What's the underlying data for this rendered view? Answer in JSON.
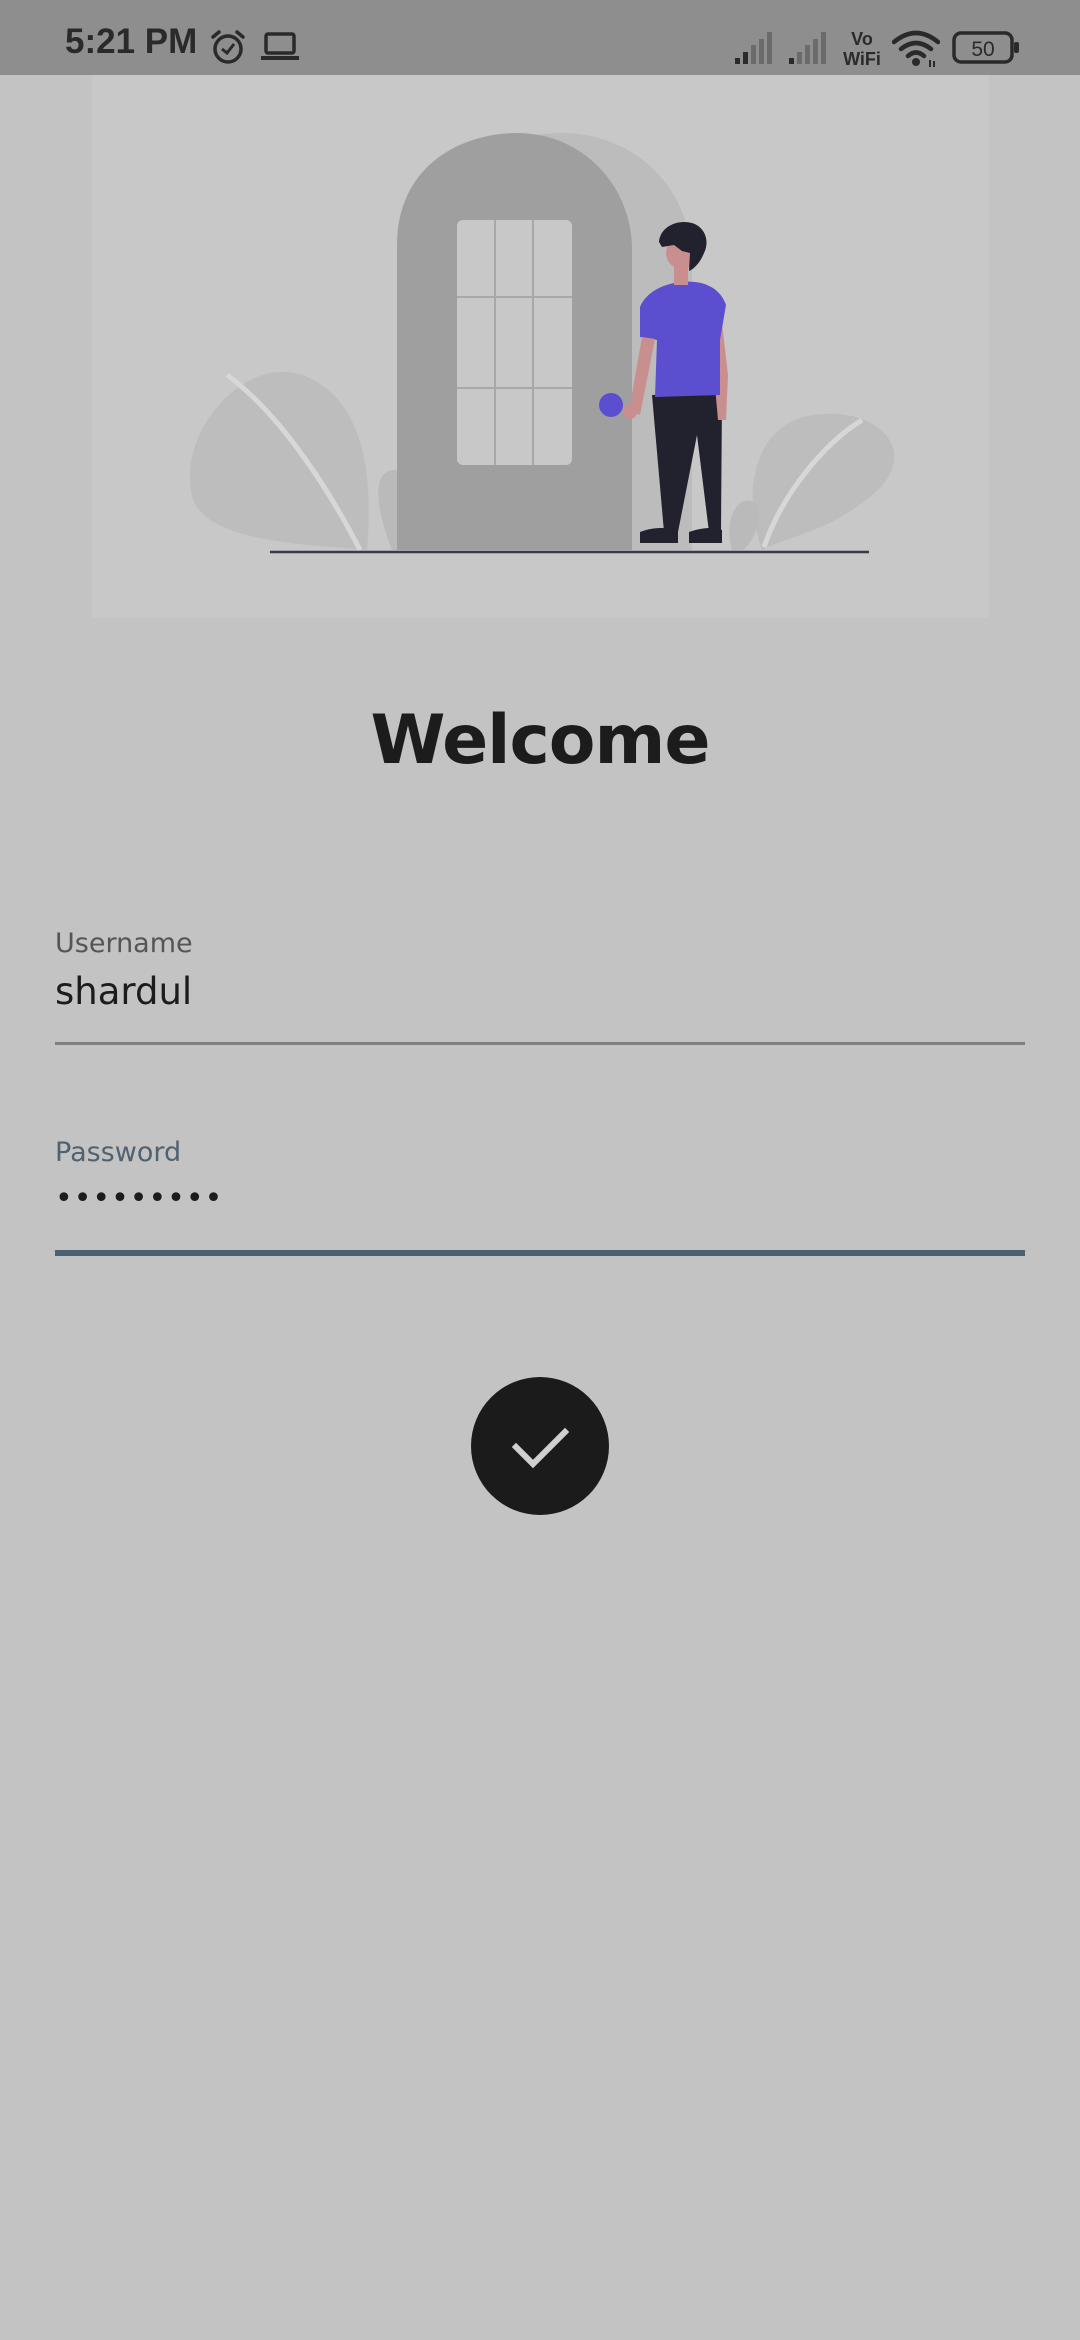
{
  "status_bar": {
    "time": "5:21 PM",
    "battery_level": "50",
    "network_label_top": "Vo",
    "network_label_bottom": "WiFi",
    "icons": [
      "alarm-icon",
      "laptop-icon",
      "signal-icon",
      "signal-icon",
      "vowifi-icon",
      "wifi-icon",
      "battery-icon"
    ]
  },
  "colors": {
    "background": "#c3c3c3",
    "accent": "#4d6171",
    "figure_shirt": "#5b4fcf",
    "button": "#1b1b1b"
  },
  "main": {
    "title": "Welcome"
  },
  "form": {
    "username": {
      "label": "Username",
      "value": "shardul"
    },
    "password": {
      "label": "Password",
      "value": "•••••••••"
    },
    "submit_icon": "checkmark-icon"
  }
}
